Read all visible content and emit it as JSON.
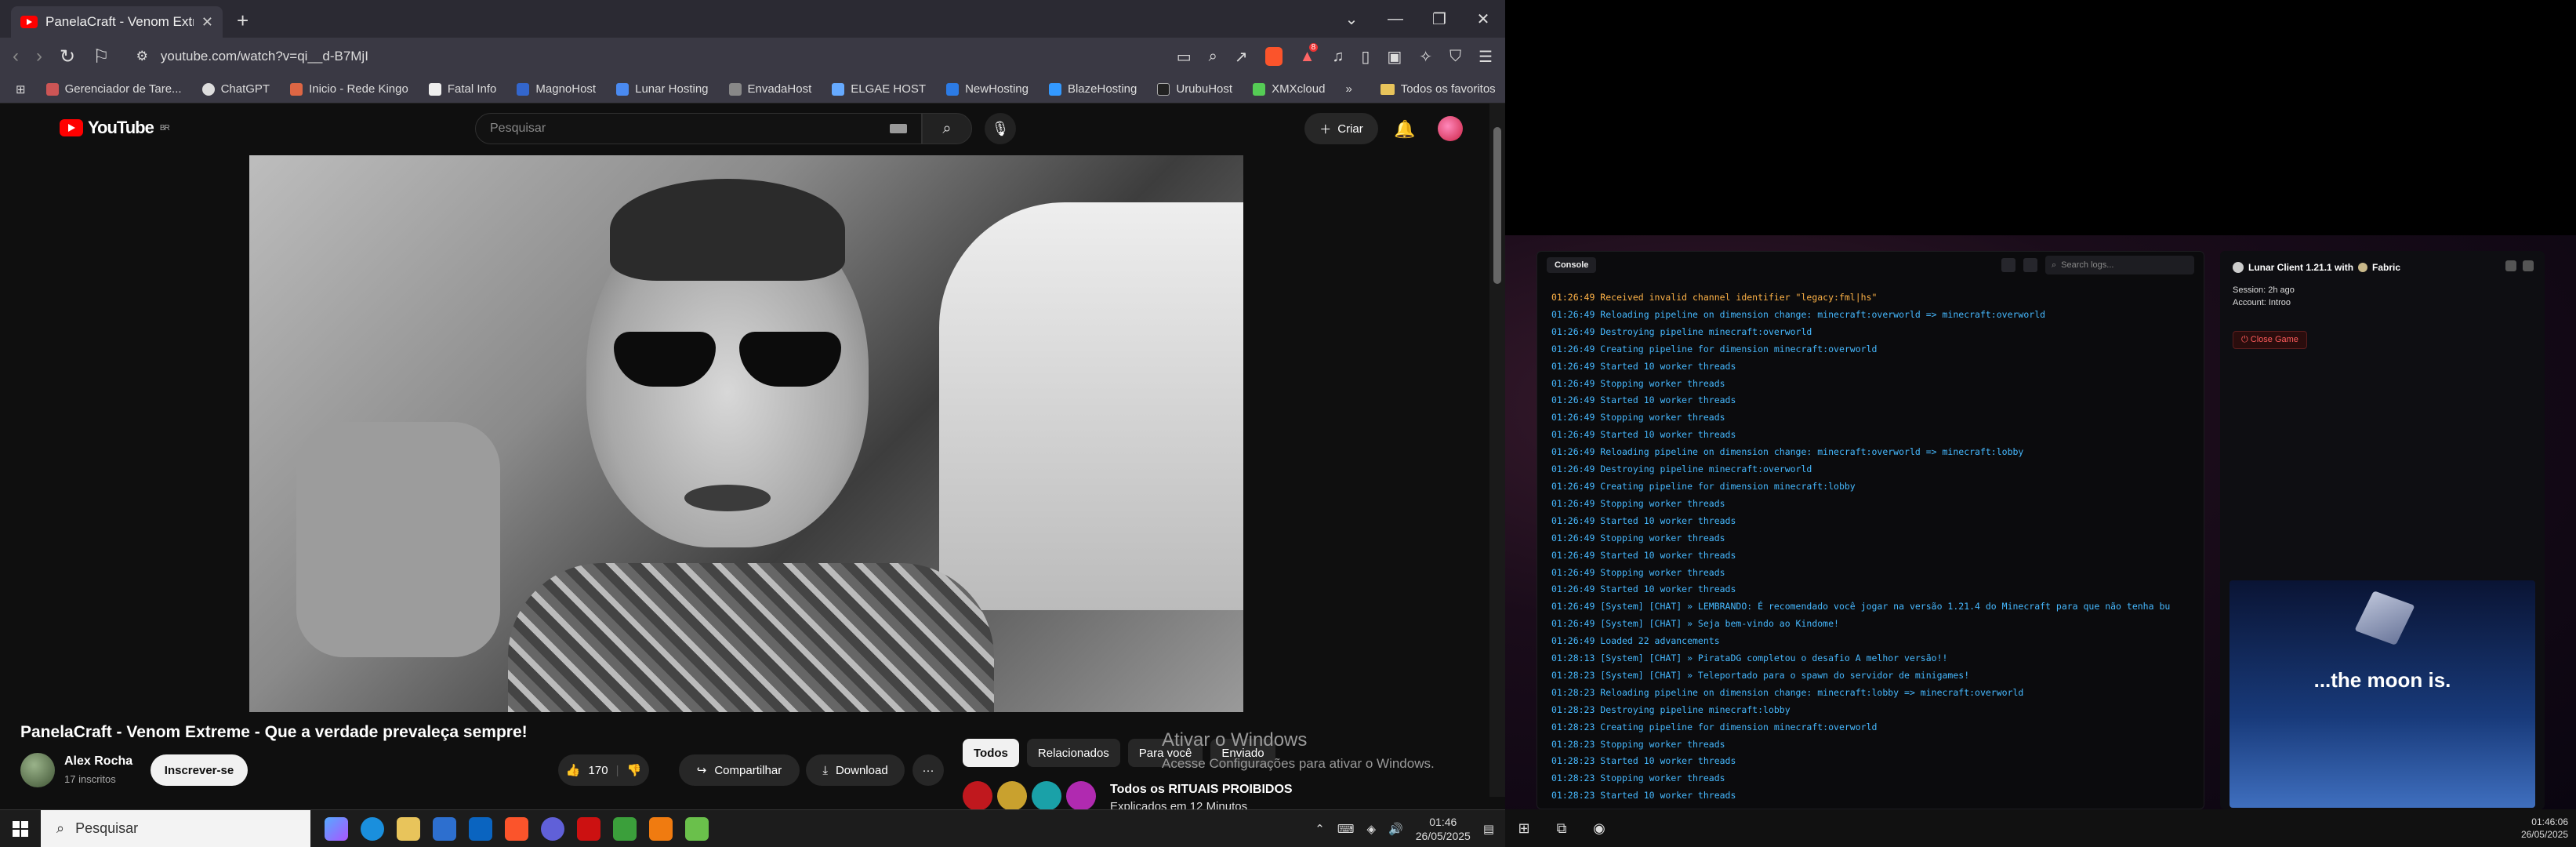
{
  "browser": {
    "tab_title": "PanelaCraft - Venom Extreme",
    "new_tab": "+",
    "url": "youtube.com/watch?v=qi__d-B7MjI",
    "badge": "8",
    "bookmarks": [
      "Gerenciador de Tare...",
      "ChatGPT",
      "Inicio - Rede Kingo",
      "Fatal Info",
      "MagnoHost",
      "Lunar Hosting",
      "EnvadaHost",
      "ELGAE HOST",
      "NewHosting",
      "BlazeHosting",
      "UrubuHost",
      "XMXcloud"
    ],
    "bookmarks_more": "»",
    "all_bookmarks": "Todos os favoritos"
  },
  "youtube": {
    "logo": "YouTube",
    "region": "BR",
    "search_placeholder": "Pesquisar",
    "create": "Criar",
    "video_title": "PanelaCraft - Venom Extreme - Que a verdade prevaleça sempre!",
    "channel": "Alex Rocha",
    "subs": "17 inscritos",
    "subscribe": "Inscrever-se",
    "likes": "170",
    "share": "Compartilhar",
    "download": "Download",
    "more": "···",
    "chips": [
      "Todos",
      "Relacionados",
      "Para você",
      "Enviado"
    ],
    "rec_title": "Todos os RITUAIS PROIBIDOS",
    "rec_sub": "Explicados em 12 Minutos",
    "activate_title": "Ativar o Windows",
    "activate_sub": "Acesse Configurações para ativar o Windows."
  },
  "taskbar": {
    "search": "Pesquisar",
    "time": "01:46",
    "date": "26/05/2025"
  },
  "launcher": {
    "console_tab": "Console",
    "search_placeholder": "Search logs...",
    "logs": [
      {
        "t": "01:26:49 Received invalid channel identifier \"legacy:fml|hs\"",
        "warn": true
      },
      {
        "t": "01:26:49 Reloading pipeline on dimension change: minecraft:overworld => minecraft:overworld"
      },
      {
        "t": "01:26:49 Destroying pipeline minecraft:overworld"
      },
      {
        "t": "01:26:49 Creating pipeline for dimension minecraft:overworld"
      },
      {
        "t": "01:26:49 Started 10 worker threads"
      },
      {
        "t": "01:26:49 Stopping worker threads"
      },
      {
        "t": "01:26:49 Started 10 worker threads"
      },
      {
        "t": "01:26:49 Stopping worker threads"
      },
      {
        "t": "01:26:49 Started 10 worker threads"
      },
      {
        "t": "01:26:49 Reloading pipeline on dimension change: minecraft:overworld => minecraft:lobby"
      },
      {
        "t": "01:26:49 Destroying pipeline minecraft:overworld"
      },
      {
        "t": "01:26:49 Creating pipeline for dimension minecraft:lobby"
      },
      {
        "t": "01:26:49 Stopping worker threads"
      },
      {
        "t": "01:26:49 Started 10 worker threads"
      },
      {
        "t": "01:26:49 Stopping worker threads"
      },
      {
        "t": "01:26:49 Started 10 worker threads"
      },
      {
        "t": "01:26:49 Stopping worker threads"
      },
      {
        "t": "01:26:49 Started 10 worker threads"
      },
      {
        "t": "01:26:49 [System] [CHAT] » LEMBRANDO: É recomendado você jogar na versão 1.21.4 do Minecraft para que não tenha bu"
      },
      {
        "t": "01:26:49 [System] [CHAT] » Seja bem-vindo ao Kindome!"
      },
      {
        "t": "01:26:49 Loaded 22 advancements"
      },
      {
        "t": "01:28:13 [System] [CHAT] » PirataDG completou o desafio A melhor versão!!"
      },
      {
        "t": "01:28:23 [System] [CHAT] » Teleportado para o spawn do servidor de minigames!"
      },
      {
        "t": "01:28:23 Reloading pipeline on dimension change: minecraft:lobby => minecraft:overworld"
      },
      {
        "t": "01:28:23 Destroying pipeline minecraft:lobby"
      },
      {
        "t": "01:28:23 Creating pipeline for dimension minecraft:overworld"
      },
      {
        "t": "01:28:23 Stopping worker threads"
      },
      {
        "t": "01:28:23 Started 10 worker threads"
      },
      {
        "t": "01:28:23 Stopping worker threads"
      },
      {
        "t": "01:28:23 Started 10 worker threads"
      }
    ],
    "panel_title": "Lunar Client 1.21.1 with",
    "loader": "Fabric",
    "session": "Session: 2h ago",
    "account": "Account: Introo",
    "close_game": "Close Game",
    "moon_text": "...the moon is."
  },
  "taskbar2": {
    "time": "01:46:06",
    "date": "26/05/2025"
  },
  "colors": {
    "yt_red": "#ff0000",
    "log_blue": "#46b9ff",
    "log_warn": "#ffb347",
    "close_red": "#ff5b5b"
  }
}
